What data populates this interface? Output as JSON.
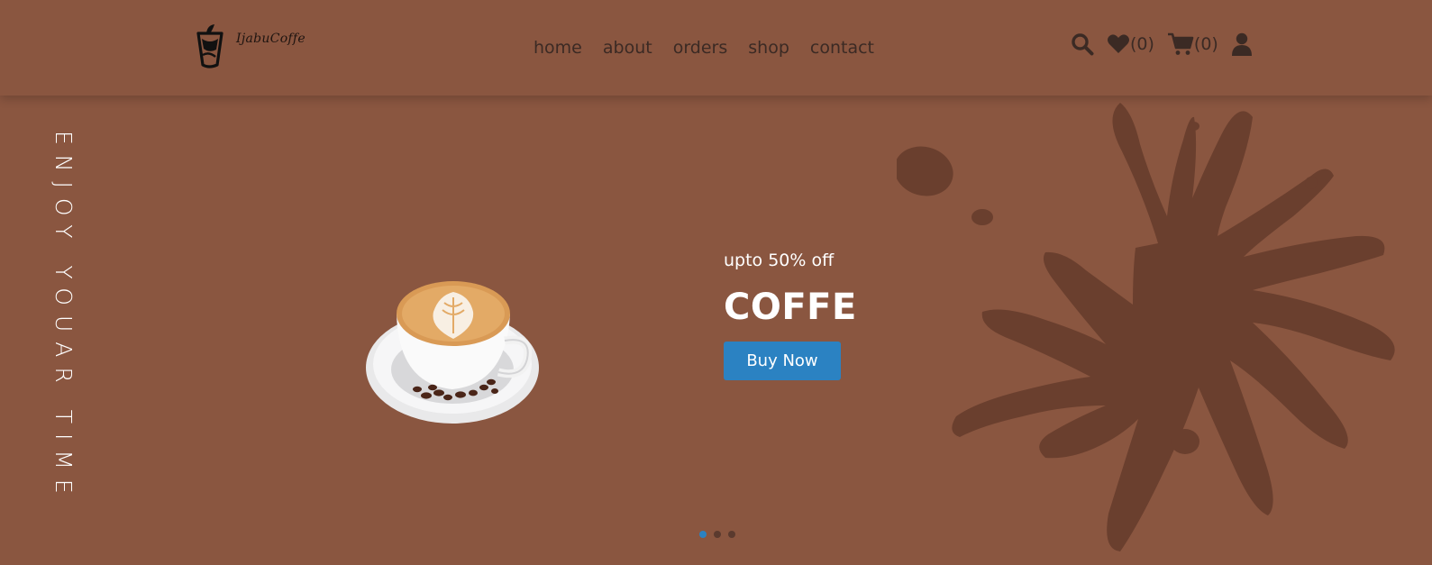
{
  "brand": {
    "name": "IjabuCoffe"
  },
  "nav": [
    {
      "label": "home"
    },
    {
      "label": "about"
    },
    {
      "label": "orders"
    },
    {
      "label": "shop"
    },
    {
      "label": "contact"
    }
  ],
  "header_icons": {
    "search": "search-icon",
    "wishlist": {
      "icon": "heart-icon",
      "count": "(0)"
    },
    "cart": {
      "icon": "cart-icon",
      "count": "(0)"
    },
    "account": "user-icon"
  },
  "hero": {
    "vertical_text": "ENJOY YOUAR TIME",
    "offer": "upto 50% off",
    "title": "COFFE",
    "button": "Buy Now"
  },
  "slider": {
    "slides": 3,
    "active": 1
  },
  "colors": {
    "background": "#8a5640",
    "splash": "#6a3f2e",
    "accent": "#2b82c2",
    "nav_text": "#3b2a24"
  }
}
